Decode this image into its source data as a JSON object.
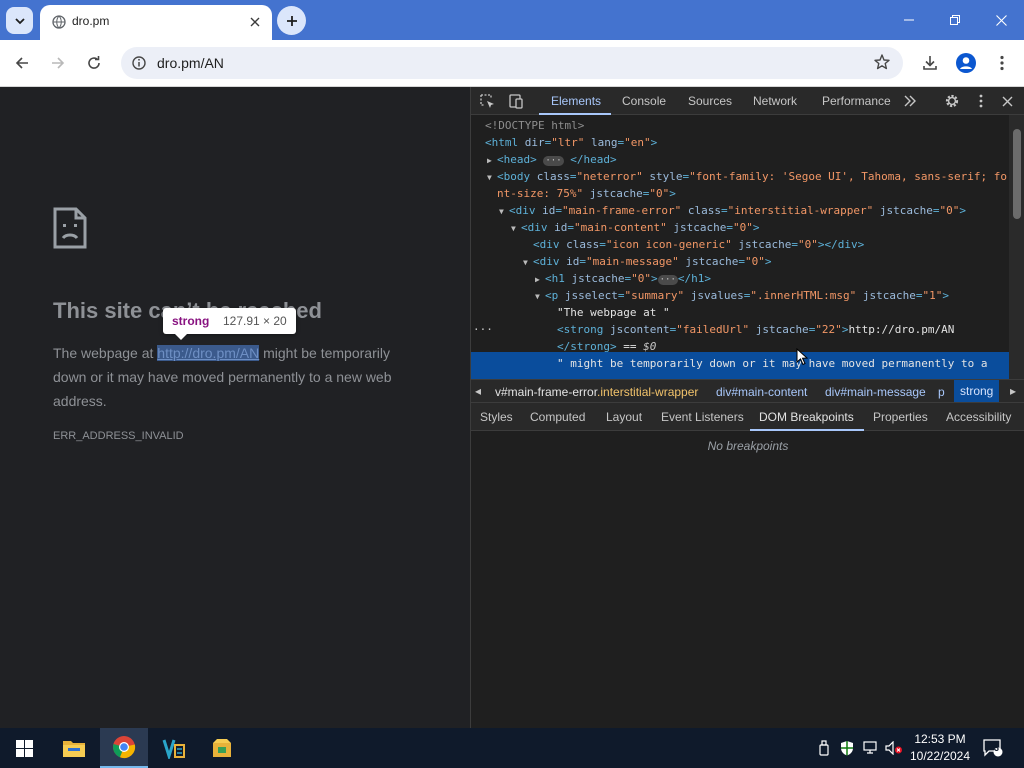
{
  "browser": {
    "tab_title": "dro.pm",
    "url": "dro.pm/AN"
  },
  "page": {
    "title": "This site can’t be reached",
    "message_before": "The webpage at ",
    "message_link": "http://dro.pm/AN",
    "message_after": " might be temporarily down or it may have moved permanently to a new web address.",
    "error_code": "ERR_ADDRESS_INVALID",
    "tooltip_tag": "strong",
    "tooltip_size": "127.91 × 20"
  },
  "devtools": {
    "tabs": [
      "Elements",
      "Console",
      "Sources",
      "Network",
      "Performance"
    ],
    "active_tab": "Elements",
    "breadcrumbs": {
      "c1_id": "v#main-frame-error",
      "c1_class": ".interstitial-wrapper",
      "c2": "div#main-content",
      "c3": "div#main-message",
      "c4": "p",
      "c5": "strong"
    },
    "sub_tabs": [
      "Styles",
      "Computed",
      "Layout",
      "Event Listeners",
      "DOM Breakpoints",
      "Properties",
      "Accessibility"
    ],
    "active_sub_tab": "DOM Breakpoints",
    "empty_message": "No breakpoints"
  },
  "taskbar": {
    "time": "12:53 PM",
    "date": "10/22/2024",
    "notification_count": "3"
  },
  "colors": {
    "chrome_blue": "#4473cf",
    "devtools_bg": "#1f1f1f",
    "selection": "#0a4d9c"
  }
}
